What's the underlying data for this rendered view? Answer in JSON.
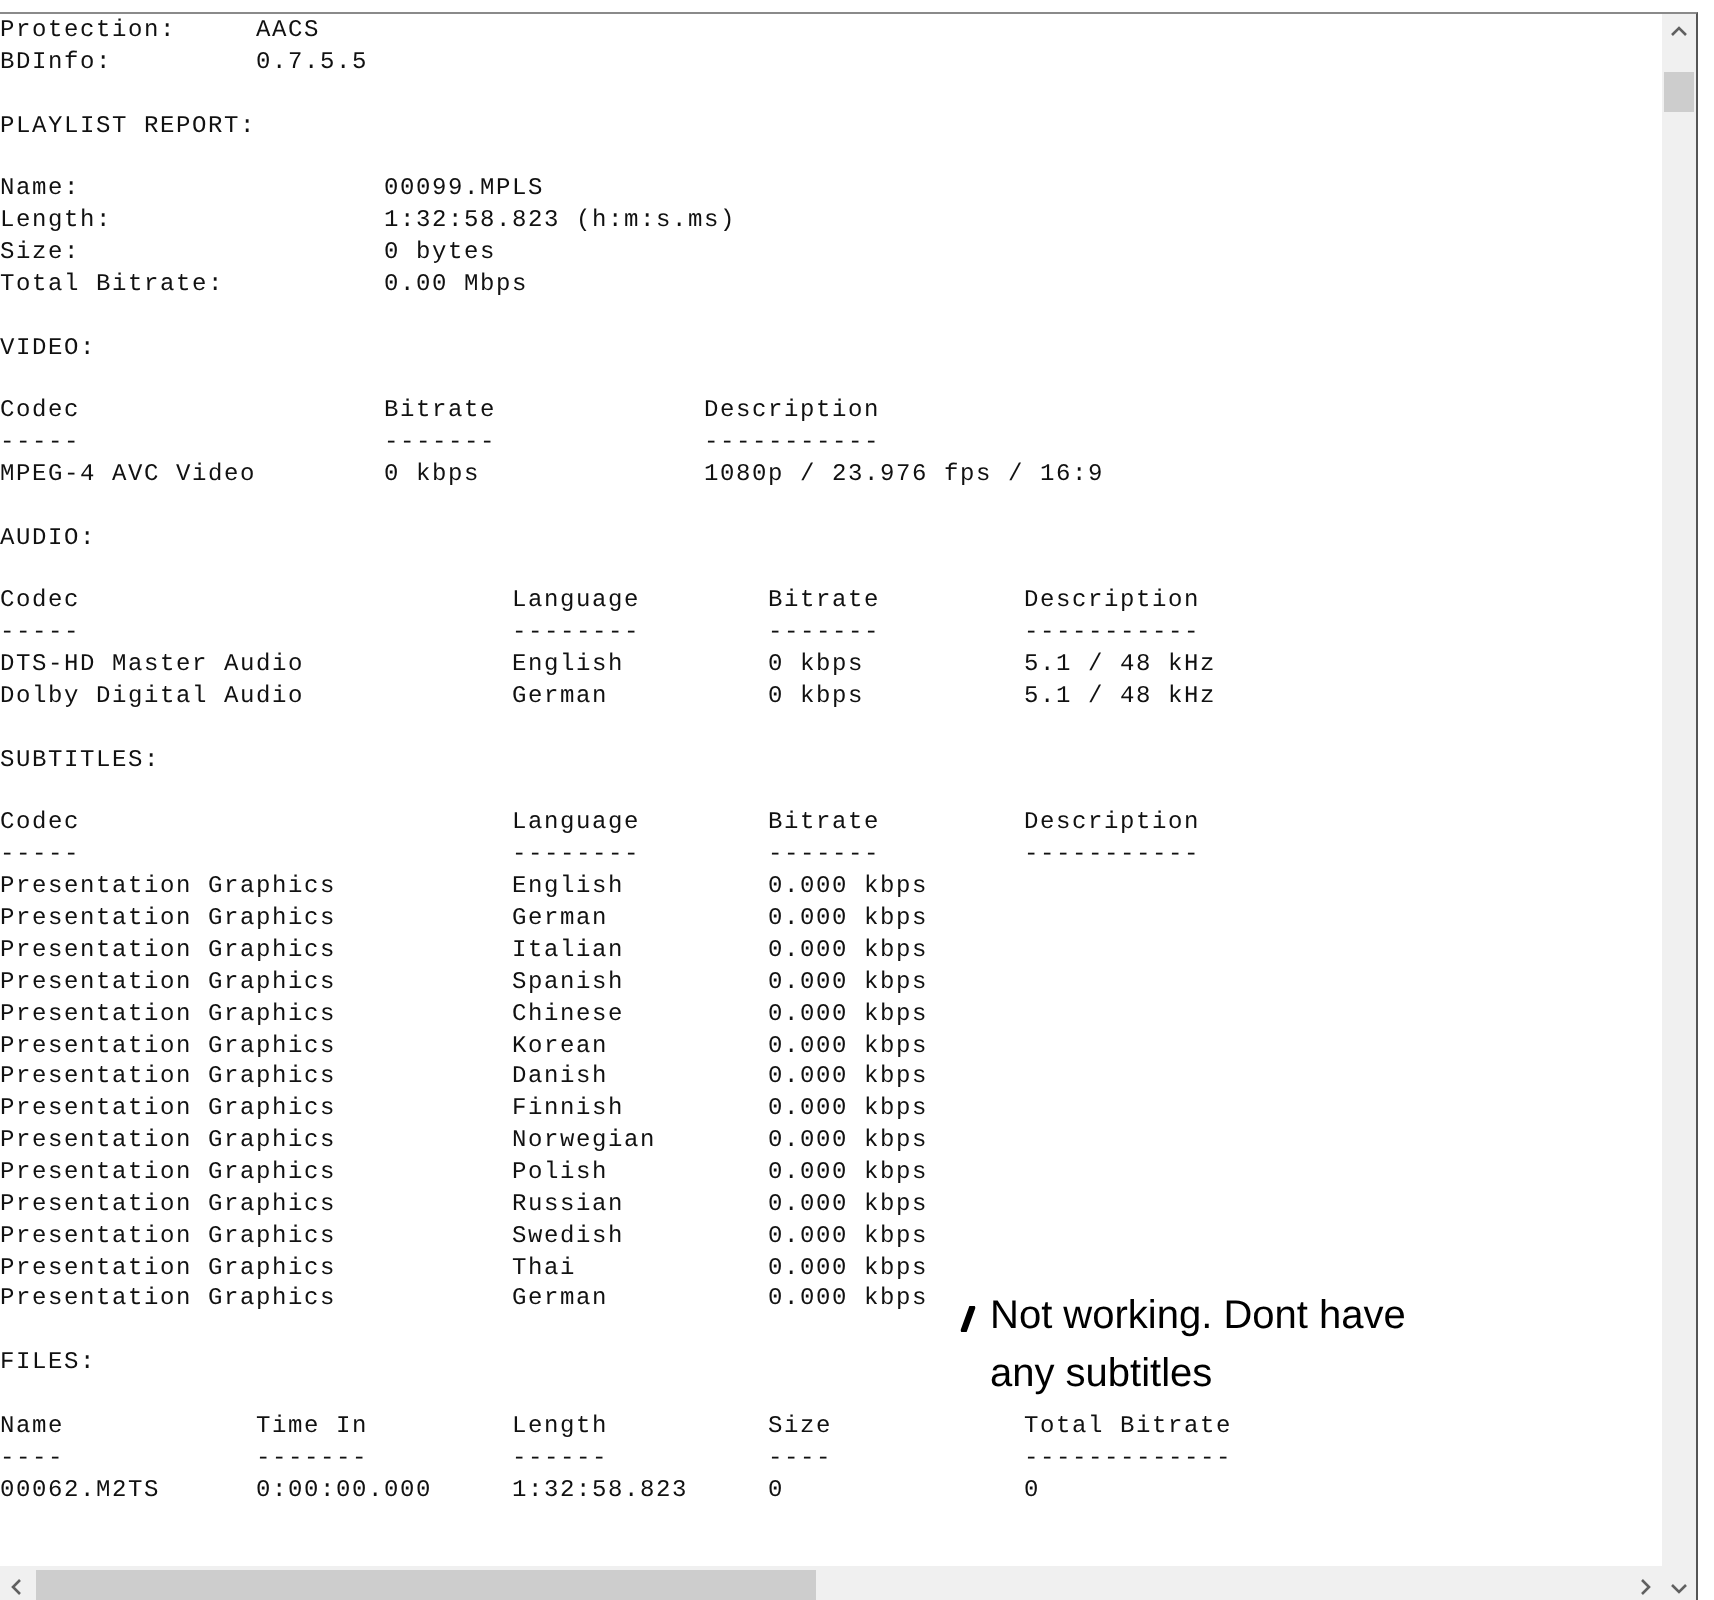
{
  "report": {
    "header_fields": [
      {
        "label": "Protection:",
        "value": "AACS"
      },
      {
        "label": "BDInfo:",
        "value": "0.7.5.5"
      }
    ],
    "playlist_report": {
      "title": "PLAYLIST REPORT:",
      "fields": [
        {
          "label": "Name:",
          "value": "00099.MPLS"
        },
        {
          "label": "Length:",
          "value": "1:32:58.823 (h:m:s.ms)"
        },
        {
          "label": "Size:",
          "value": "0 bytes"
        },
        {
          "label": "Total Bitrate:",
          "value": "0.00 Mbps"
        }
      ]
    },
    "sections": [
      {
        "kind": "video",
        "title": "VIDEO:",
        "columns": [
          {
            "label": "Codec",
            "rule": "-----"
          },
          {
            "label": "Bitrate",
            "rule": "-------"
          },
          {
            "label": "Description",
            "rule": "-----------"
          }
        ],
        "rows": [
          [
            "MPEG-4 AVC Video",
            "0 kbps",
            "1080p / 23.976 fps / 16:9"
          ]
        ]
      },
      {
        "kind": "audio",
        "title": "AUDIO:",
        "columns": [
          {
            "label": "Codec",
            "rule": "-----"
          },
          {
            "label": "Language",
            "rule": "--------"
          },
          {
            "label": "Bitrate",
            "rule": "-------"
          },
          {
            "label": "Description",
            "rule": "-----------"
          }
        ],
        "rows": [
          [
            "DTS-HD Master Audio",
            "English",
            "0 kbps",
            "5.1 / 48 kHz"
          ],
          [
            "Dolby Digital Audio",
            "German",
            "0 kbps",
            "5.1 / 48 kHz"
          ]
        ]
      },
      {
        "kind": "subtitles",
        "title": "SUBTITLES:",
        "columns": [
          {
            "label": "Codec",
            "rule": "-----"
          },
          {
            "label": "Language",
            "rule": "--------"
          },
          {
            "label": "Bitrate",
            "rule": "-------"
          },
          {
            "label": "Description",
            "rule": "-----------"
          }
        ],
        "rows": [
          [
            "Presentation Graphics",
            "English",
            "0.000 kbps"
          ],
          [
            "Presentation Graphics",
            "German",
            "0.000 kbps"
          ],
          [
            "Presentation Graphics",
            "Italian",
            "0.000 kbps"
          ],
          [
            "Presentation Graphics",
            "Spanish",
            "0.000 kbps"
          ],
          [
            "Presentation Graphics",
            "Chinese",
            "0.000 kbps"
          ],
          [
            "Presentation Graphics",
            "Korean",
            "0.000 kbps"
          ],
          [
            "Presentation Graphics",
            "Danish",
            "0.000 kbps"
          ],
          [
            "Presentation Graphics",
            "Finnish",
            "0.000 kbps"
          ],
          [
            "Presentation Graphics",
            "Norwegian",
            "0.000 kbps"
          ],
          [
            "Presentation Graphics",
            "Polish",
            "0.000 kbps"
          ],
          [
            "Presentation Graphics",
            "Russian",
            "0.000 kbps"
          ],
          [
            "Presentation Graphics",
            "Swedish",
            "0.000 kbps"
          ],
          [
            "Presentation Graphics",
            "Thai",
            "0.000 kbps"
          ],
          [
            "Presentation Graphics",
            "German",
            "0.000 kbps"
          ]
        ]
      },
      {
        "kind": "files",
        "title": "FILES:",
        "columns": [
          {
            "label": "Name",
            "rule": "----"
          },
          {
            "label": "Time In",
            "rule": "-------"
          },
          {
            "label": "Length",
            "rule": "------"
          },
          {
            "label": "Size",
            "rule": "----"
          },
          {
            "label": "Total Bitrate",
            "rule": "-------------"
          }
        ],
        "rows": [
          [
            "00062.M2TS",
            "0:00:00.000",
            "1:32:58.823",
            "0",
            "0"
          ]
        ]
      }
    ]
  },
  "annotation": {
    "text": "Not working. Dont have any subtitles"
  }
}
